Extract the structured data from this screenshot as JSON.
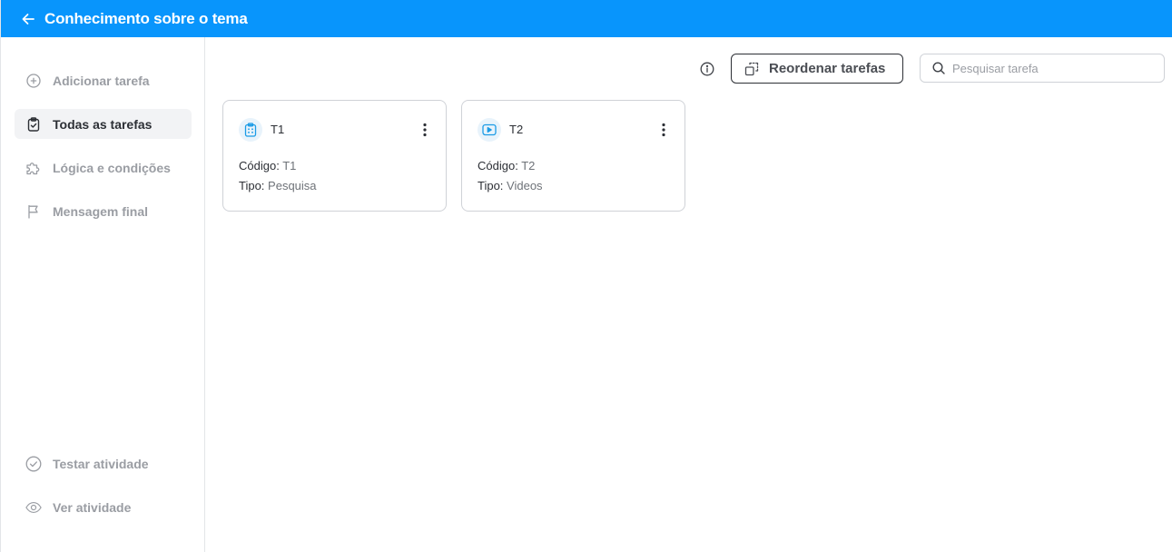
{
  "header": {
    "title": "Conhecimento sobre o tema",
    "back_icon": "arrow-left-icon",
    "background": "#0895fc"
  },
  "sidebar": {
    "items": [
      {
        "label": "Adicionar tarefa",
        "icon": "plus-circle-icon",
        "active": false
      },
      {
        "label": "Todas as tarefas",
        "icon": "clipboard-check-icon",
        "active": true
      },
      {
        "label": "Lógica e condições",
        "icon": "puzzle-icon",
        "active": false
      },
      {
        "label": "Mensagem final",
        "icon": "flag-icon",
        "active": false
      }
    ],
    "bottom_items": [
      {
        "label": "Testar atividade",
        "icon": "check-circle-icon"
      },
      {
        "label": "Ver atividade",
        "icon": "eye-icon"
      }
    ]
  },
  "toolbar": {
    "info_icon": "info-icon",
    "reorder_label": "Reordenar tarefas",
    "reorder_icon": "reorder-icon",
    "search_placeholder": "Pesquisar tarefa",
    "search_value": ""
  },
  "tasks": [
    {
      "title": "T1",
      "code_label": "Código:",
      "code": "T1",
      "type_label": "Tipo:",
      "type": "Pesquisa",
      "icon": "clipboard-grid-icon"
    },
    {
      "title": "T2",
      "code_label": "Código:",
      "code": "T2",
      "type_label": "Tipo:",
      "type": "Videos",
      "icon": "play-video-icon"
    }
  ],
  "colors": {
    "accent": "#0895fc",
    "icon_blue": "#1a9be6",
    "text_dark": "#2c2f35",
    "text_muted": "#9a9da3"
  }
}
